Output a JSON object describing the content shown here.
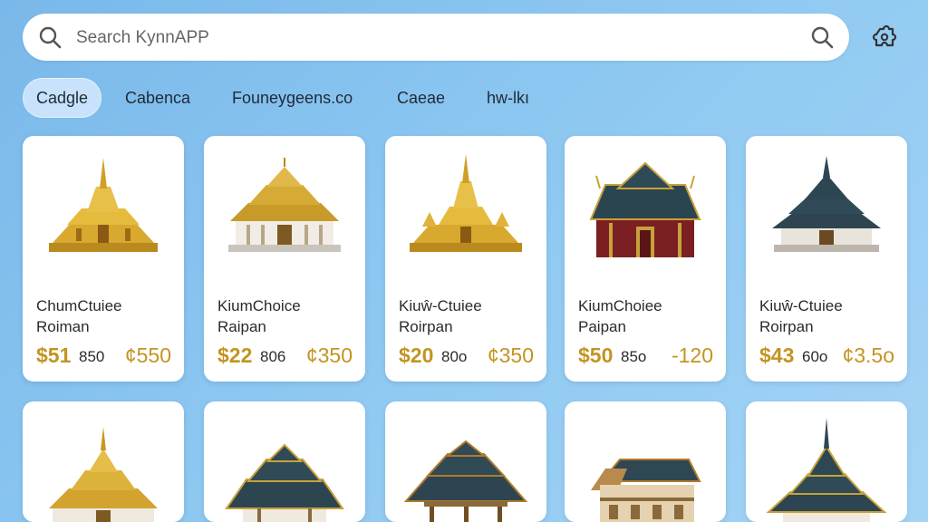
{
  "search": {
    "placeholder": "Search KynnAPP",
    "value": "",
    "leading_icon": "search-icon",
    "trailing_icon": "search-icon"
  },
  "settings_icon": "puzzle-gear-icon",
  "tabs": [
    {
      "label": "Cadgle",
      "active": true
    },
    {
      "label": "Cabenca",
      "active": false
    },
    {
      "label": "Founeygeens.co",
      "active": false
    },
    {
      "label": "Caeae",
      "active": false
    },
    {
      "label": "hw-lkı",
      "active": false
    }
  ],
  "products_row1": [
    {
      "title": "ChumCtuiee",
      "subtitle": "Roiman",
      "price": "$51",
      "old_price": "850",
      "alt_price": "¢550"
    },
    {
      "title": "KiumChoice",
      "subtitle": "Raipan",
      "price": "$22",
      "old_price": "806",
      "alt_price": "¢350"
    },
    {
      "title": "Kiuŵ-Ctuiee",
      "subtitle": "Roirpan",
      "price": "$20",
      "old_price": "80o",
      "alt_price": "¢350"
    },
    {
      "title": "KiumChoiee",
      "subtitle": "Paipan",
      "price": "$50",
      "old_price": "85o",
      "alt_price": "-120"
    },
    {
      "title": "Kiuŵ-Ctuiee",
      "subtitle": "Roirpan",
      "price": "$43",
      "old_price": "60o",
      "alt_price": "¢3.5o"
    }
  ],
  "products_row2_icons": [
    "golden-temple-icon",
    "thai-pavilion-icon",
    "thai-pavilion-icon",
    "wooden-house-icon",
    "thai-pagoda-icon"
  ],
  "colors": {
    "background": "#8cc7f1",
    "accent_gold": "#c39421",
    "active_tab": "#c7e2fa"
  }
}
